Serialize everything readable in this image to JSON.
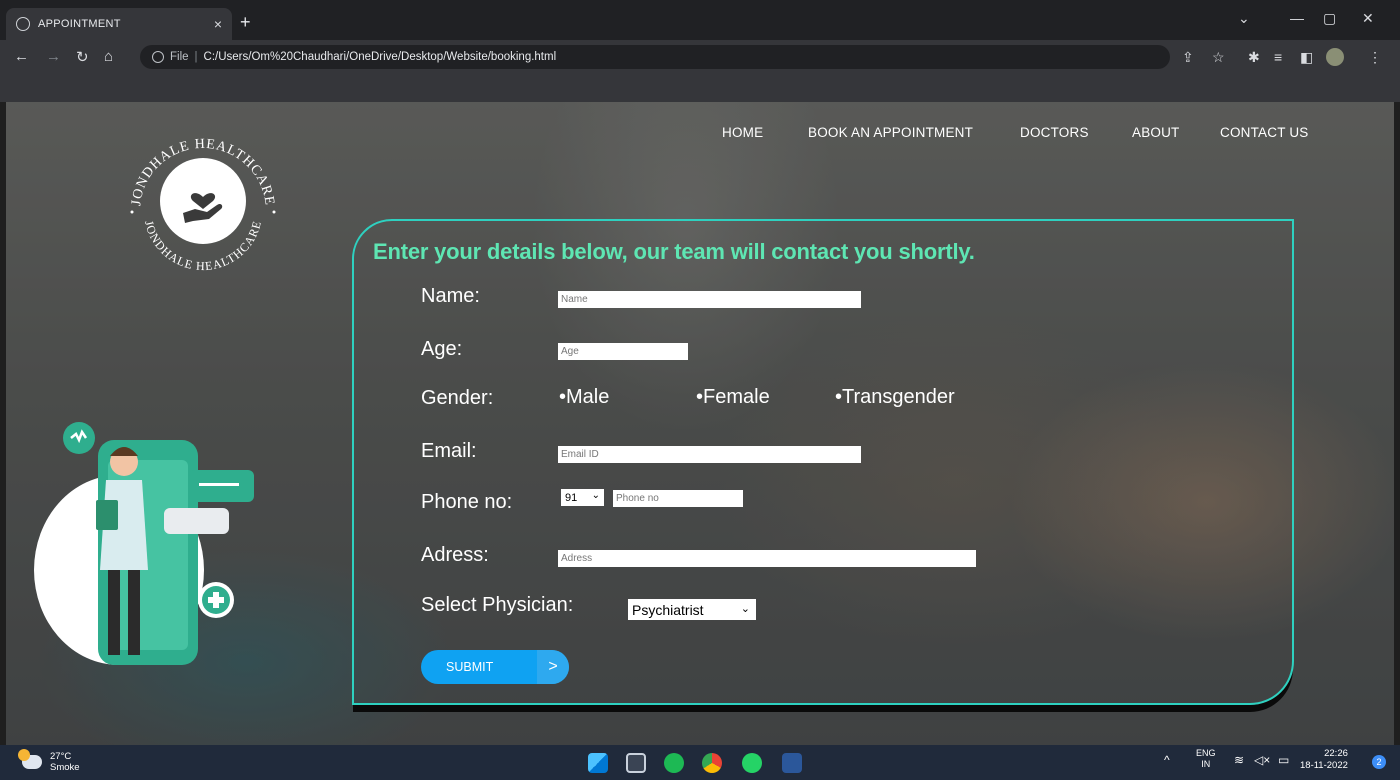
{
  "browser": {
    "tab_title": "APPOINTMENT",
    "tab_close": "×",
    "new_tab": "+",
    "url_file": "File",
    "url_sep": "|",
    "url_path": "C:/Users/Om%20Chaudhari/OneDrive/Desktop/Website/booking.html"
  },
  "logo": {
    "text_top": "JONDHALE HEALTHCARE",
    "text_bottom": "JONDHALE HEALTHCARE"
  },
  "nav": [
    "HOME",
    "BOOK AN APPOINTMENT",
    "DOCTORS",
    "ABOUT",
    "CONTACT US"
  ],
  "form": {
    "heading": "Enter your details below, our team will contact you shortly.",
    "name_label": "Name:",
    "name_placeholder": "Name",
    "age_label": "Age:",
    "age_placeholder": "Age",
    "gender_label": "Gender:",
    "gender_options": [
      "•Male",
      "•Female",
      "•Transgender"
    ],
    "email_label": "Email:",
    "email_placeholder": "Email ID",
    "phone_label": "Phone no:",
    "phone_code": "91",
    "phone_placeholder": "Phone no",
    "address_label": "Adress:",
    "address_placeholder": "Adress",
    "physician_label": "Select Physician:",
    "physician_value": "Psychiatrist",
    "submit_label": "SUBMIT",
    "submit_arrow": ">"
  },
  "taskbar": {
    "temperature": "27°C",
    "weather": "Smoke",
    "lang_top": "ENG",
    "lang_bottom": "IN",
    "time": "22:26",
    "date": "18-11-2022",
    "notifications": "2"
  }
}
